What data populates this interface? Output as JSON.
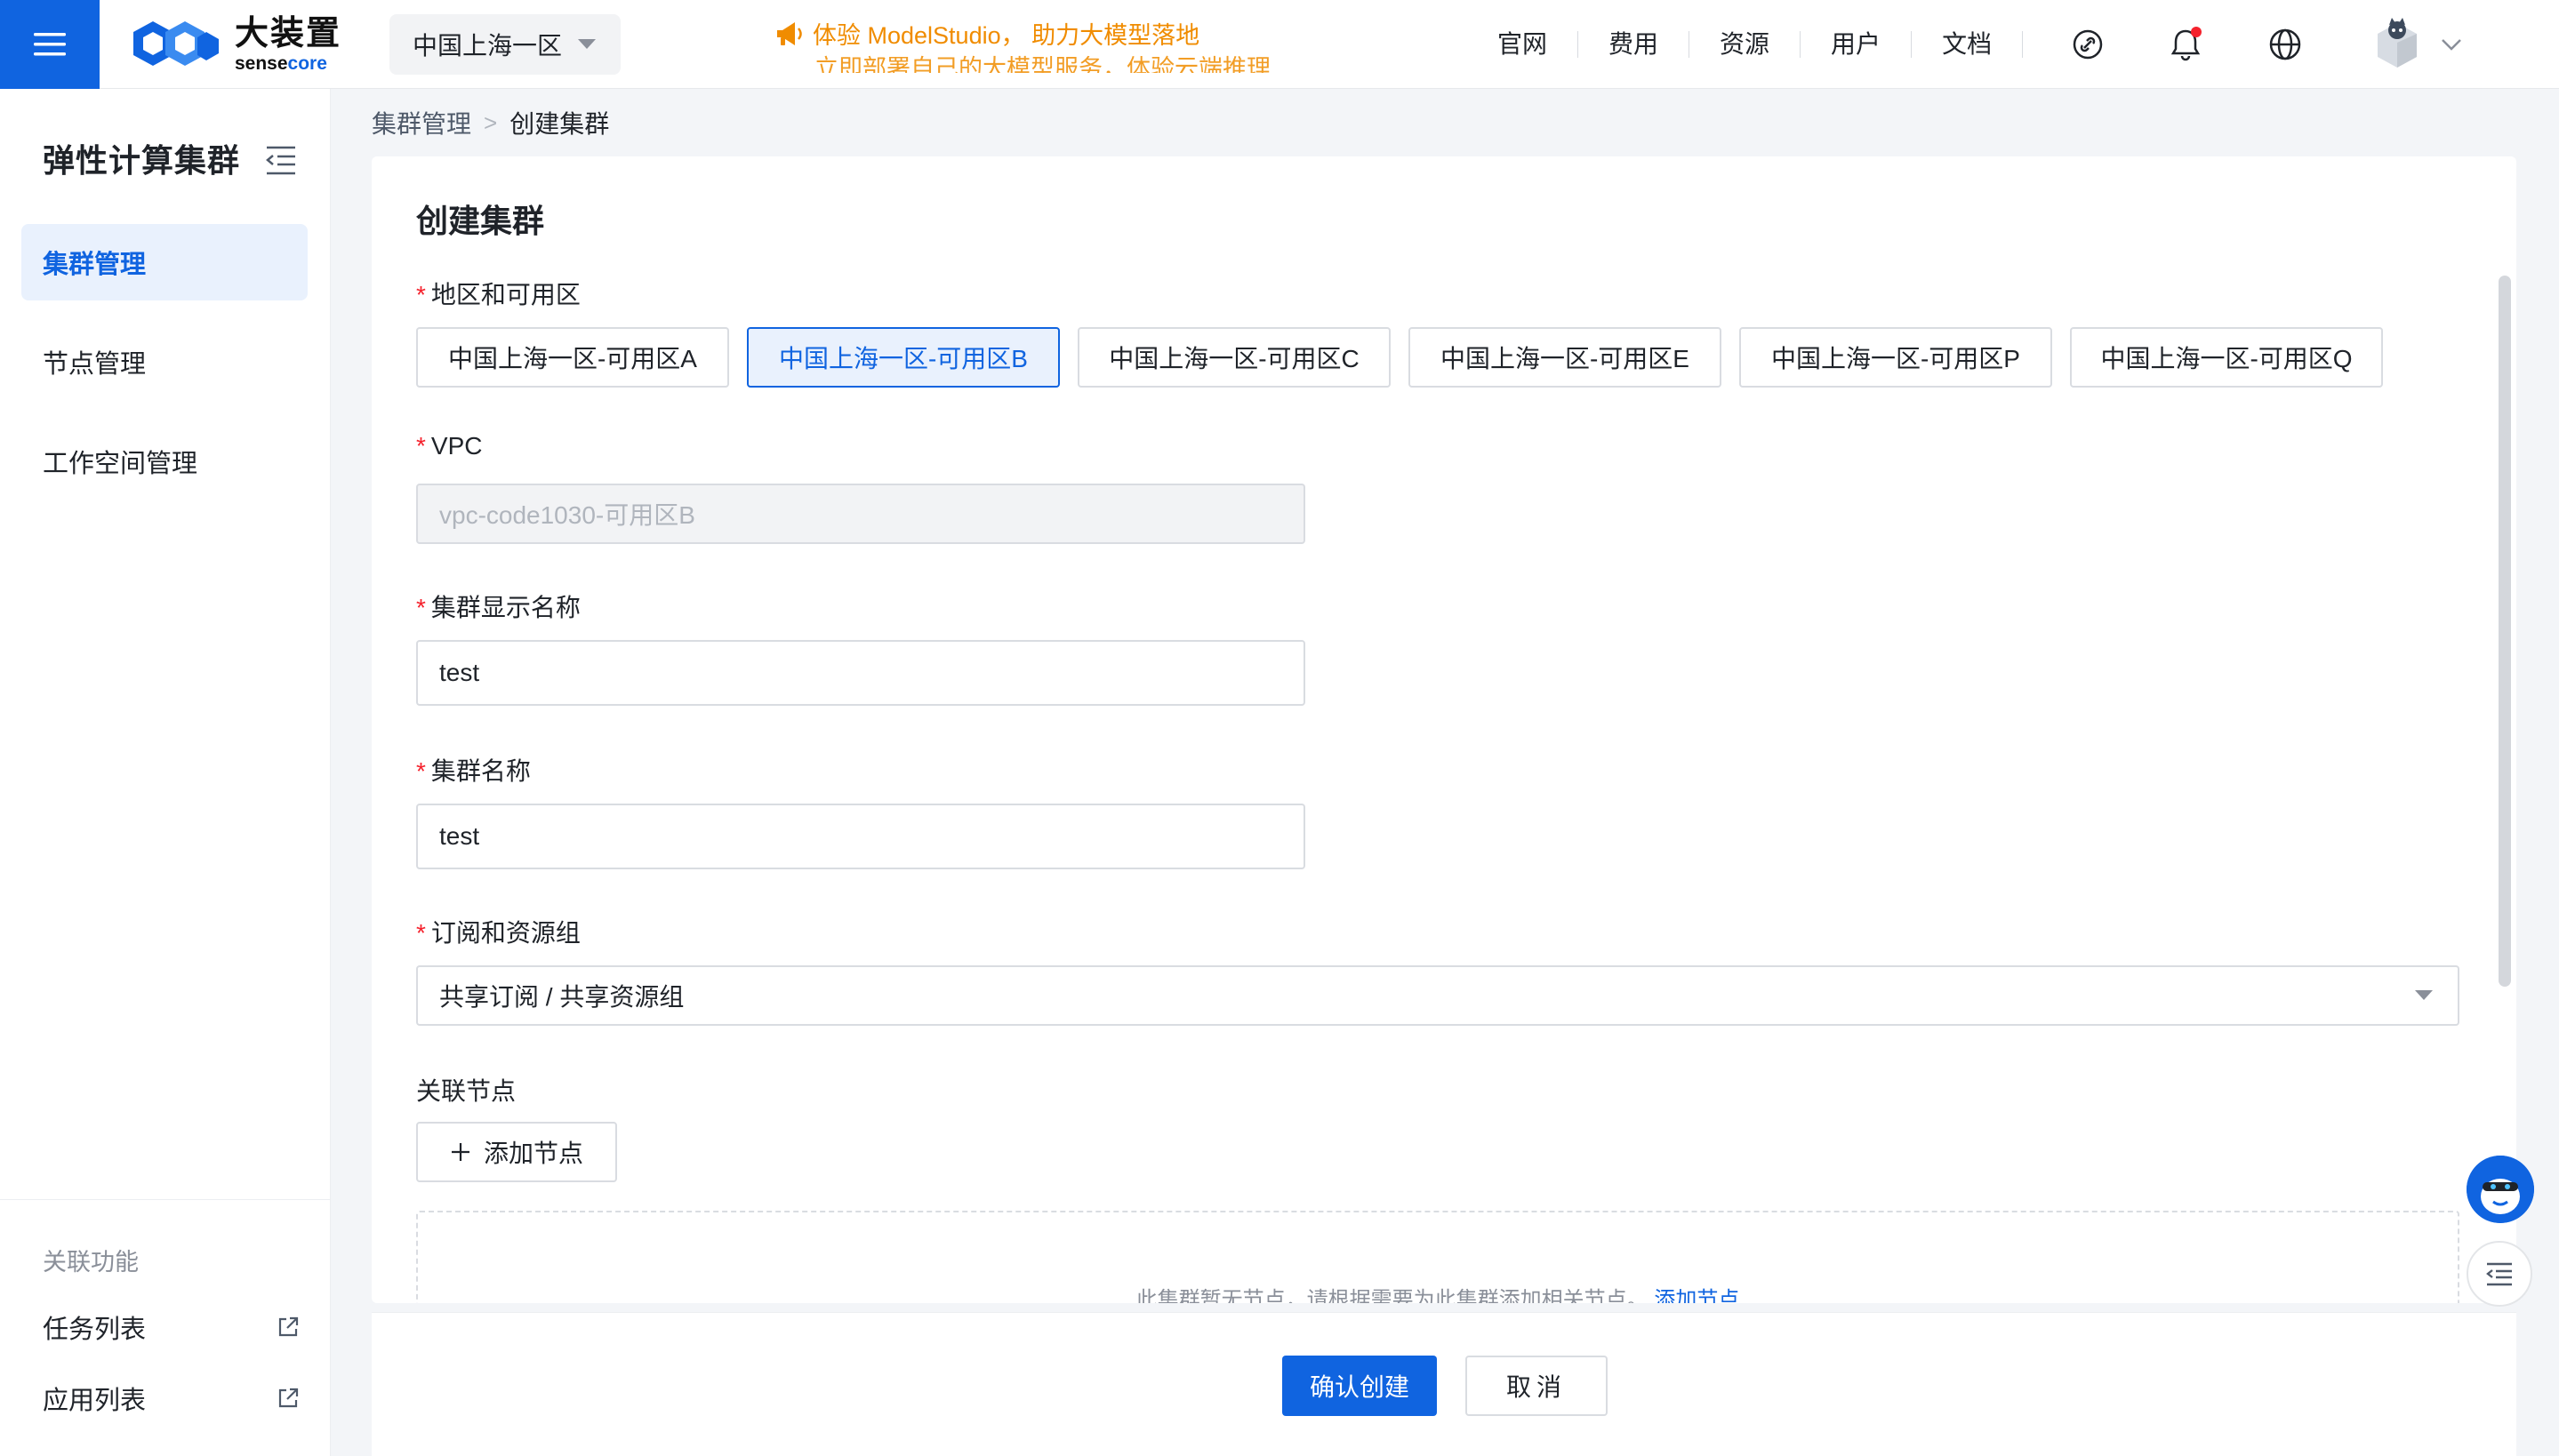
{
  "header": {
    "logo_main": "大装置",
    "logo_sub_a": "sense",
    "logo_sub_b": "core",
    "region": "中国上海一区",
    "promo_line1": "体验 ModelStudio， 助力大模型落地",
    "promo_line2": "立即部署自己的大模型服务，体验云端推理能力",
    "nav": [
      "官网",
      "费用",
      "资源",
      "用户",
      "文档"
    ],
    "colors": {
      "brand": "#1064e0",
      "promo": "#f08c00",
      "alert": "#f5222d"
    }
  },
  "sidebar": {
    "title": "弹性计算集群",
    "items": [
      {
        "label": "集群管理",
        "active": true
      },
      {
        "label": "节点管理",
        "active": false
      },
      {
        "label": "工作空间管理",
        "active": false
      }
    ],
    "section_title": "关联功能",
    "links": [
      {
        "label": "任务列表"
      },
      {
        "label": "应用列表"
      }
    ]
  },
  "breadcrumb": {
    "parent": "集群管理",
    "separator": ">",
    "current": "创建集群"
  },
  "form": {
    "title": "创建集群",
    "zone": {
      "label": "地区和可用区",
      "options": [
        "中国上海一区-可用区A",
        "中国上海一区-可用区B",
        "中国上海一区-可用区C",
        "中国上海一区-可用区E",
        "中国上海一区-可用区P",
        "中国上海一区-可用区Q"
      ],
      "selected": "中国上海一区-可用区B"
    },
    "vpc": {
      "label": "VPC",
      "value": "vpc-code1030-可用区B"
    },
    "display_name": {
      "label": "集群显示名称",
      "value": "test"
    },
    "name": {
      "label": "集群名称",
      "value": "test"
    },
    "subscription": {
      "label": "订阅和资源组",
      "value": "共享订阅 / 共享资源组"
    },
    "nodes": {
      "label": "关联节点",
      "add_button": "添加节点",
      "empty_text": "此集群暂无节点，请根据需要为此集群添加相关节点。",
      "empty_link": "添加节点"
    },
    "confirm_button": "确认创建",
    "cancel_button": "取消"
  }
}
